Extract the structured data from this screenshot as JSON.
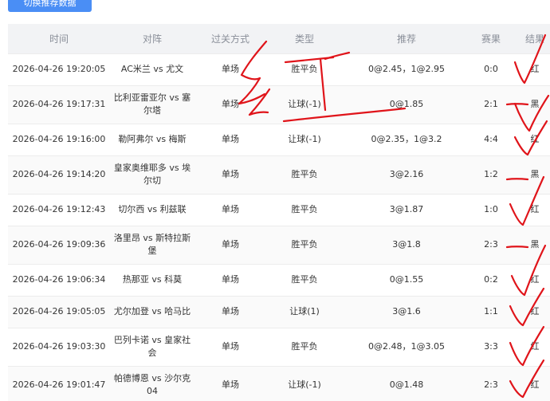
{
  "toolbar": {
    "button_label": "切换推荐数据"
  },
  "table": {
    "headers": {
      "time": "时间",
      "match": "对阵",
      "pass": "过关方式",
      "type": "类型",
      "rec": "推荐",
      "score": "赛果",
      "result": "结果"
    },
    "rows": [
      {
        "time": "2026-04-26 19:20:05",
        "match": "AC米兰 vs 尤文",
        "pass": "单场",
        "type": "胜平负",
        "rec": "0@2.45，1@2.95",
        "score": "0:0",
        "result": "红"
      },
      {
        "time": "2026-04-26 19:17:31",
        "match": "比利亚雷亚尔 vs 塞尔塔",
        "pass": "单场",
        "type": "让球(-1)",
        "rec": "0@1.85",
        "score": "2:1",
        "result": "黑"
      },
      {
        "time": "2026-04-26 19:16:00",
        "match": "勒阿弗尔 vs 梅斯",
        "pass": "单场",
        "type": "让球(-1)",
        "rec": "0@2.35，1@3.2",
        "score": "4:4",
        "result": "红"
      },
      {
        "time": "2026-04-26 19:14:20",
        "match": "皇家奥维耶多 vs 埃尔切",
        "pass": "单场",
        "type": "胜平负",
        "rec": "3@2.16",
        "score": "1:2",
        "result": "黑"
      },
      {
        "time": "2026-04-26 19:12:43",
        "match": "切尔西 vs 利兹联",
        "pass": "单场",
        "type": "胜平负",
        "rec": "3@1.87",
        "score": "1:0",
        "result": "红"
      },
      {
        "time": "2026-04-26 19:09:36",
        "match": "洛里昂 vs 斯特拉斯堡",
        "pass": "单场",
        "type": "胜平负",
        "rec": "3@1.8",
        "score": "2:3",
        "result": "黑"
      },
      {
        "time": "2026-04-26 19:06:34",
        "match": "热那亚 vs 科莫",
        "pass": "单场",
        "type": "胜平负",
        "rec": "0@1.55",
        "score": "0:2",
        "result": "红"
      },
      {
        "time": "2026-04-26 19:05:05",
        "match": "尤尔加登 vs 哈马比",
        "pass": "单场",
        "type": "让球(1)",
        "rec": "3@1.6",
        "score": "1:1",
        "result": "红"
      },
      {
        "time": "2026-04-26 19:03:30",
        "match": "巴列卡诺 vs 皇家社会",
        "pass": "单场",
        "type": "胜平负",
        "rec": "0@2.48，1@3.05",
        "score": "3:3",
        "result": "红"
      },
      {
        "time": "2026-04-26 19:01:47",
        "match": "帕德博恩 vs 沙尔克04",
        "pass": "单场",
        "type": "让球(-1)",
        "rec": "0@1.48",
        "score": "2:3",
        "result": "红"
      }
    ]
  },
  "colors": {
    "button": "#4a8ef5",
    "header_bg": "#f2f3f5",
    "annotation_ink": "#e0141a"
  }
}
